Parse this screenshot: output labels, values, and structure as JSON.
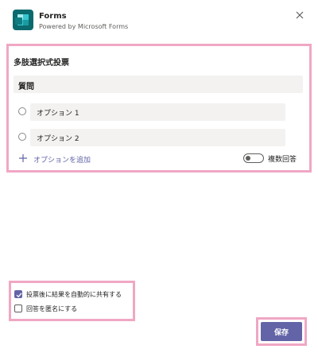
{
  "header": {
    "app_name": "Forms",
    "subtitle": "Powered by Microsoft Forms",
    "app_icon": "forms-app-icon",
    "close_icon": "close-icon"
  },
  "poll": {
    "title": "多肢選択式投票",
    "question_placeholder": "質問",
    "options": [
      "オプション 1",
      "オプション 2"
    ],
    "add_option_label": "オプションを追加",
    "multiple_answers_label": "複数回答",
    "multiple_answers_on": false
  },
  "settings": {
    "share_results_label": "投票後に結果を自動的に共有する",
    "share_results_checked": true,
    "anonymous_label": "回答を匿名にする",
    "anonymous_checked": false
  },
  "footer": {
    "save_label": "保存"
  },
  "colors": {
    "accent": "#6264a7",
    "highlight_border": "#f0a7c4",
    "field_bg": "#f3f2f1",
    "app_icon_bg": "#0b6a6e"
  }
}
